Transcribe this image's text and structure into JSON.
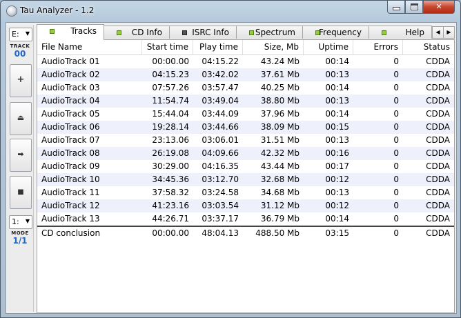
{
  "window": {
    "title": "Tau Analyzer - 1.2"
  },
  "sidebar": {
    "drive": "E:",
    "track_label": "TRACK",
    "track_value": "00",
    "buttons": [
      {
        "icon": "plus-icon",
        "glyph": "+"
      },
      {
        "icon": "eject-icon",
        "glyph": "⏏"
      },
      {
        "icon": "play-icon",
        "glyph": "➡"
      },
      {
        "icon": "stop-icon",
        "glyph": "■"
      }
    ],
    "mode_select": "1:",
    "mode_label": "MODE",
    "mode_value": "1/1"
  },
  "tabs": [
    {
      "label": "Tracks",
      "active": true,
      "dot": "green"
    },
    {
      "label": "CD Info",
      "active": false,
      "dot": "green"
    },
    {
      "label": "ISRC Info",
      "active": false,
      "dot": "grey"
    },
    {
      "label": "Spectrum",
      "active": false,
      "dot": "green"
    },
    {
      "label": "Frequency",
      "active": false,
      "dot": "green"
    },
    {
      "label": "Help",
      "active": false,
      "dot": "green"
    }
  ],
  "table": {
    "columns": [
      "File Name",
      "Start time",
      "Play time",
      "Size, Mb",
      "Uptime",
      "Errors",
      "Status"
    ],
    "rows": [
      [
        "AudioTrack 01",
        "00:00.00",
        "04:15.22",
        "43.24 Mb",
        "00:14",
        "0",
        "CDDA"
      ],
      [
        "AudioTrack 02",
        "04:15.23",
        "03:42.02",
        "37.61 Mb",
        "00:13",
        "0",
        "CDDA"
      ],
      [
        "AudioTrack 03",
        "07:57.26",
        "03:57.47",
        "40.25 Mb",
        "00:14",
        "0",
        "CDDA"
      ],
      [
        "AudioTrack 04",
        "11:54.74",
        "03:49.04",
        "38.80 Mb",
        "00:13",
        "0",
        "CDDA"
      ],
      [
        "AudioTrack 05",
        "15:44.04",
        "03:44.09",
        "37.96 Mb",
        "00:14",
        "0",
        "CDDA"
      ],
      [
        "AudioTrack 06",
        "19:28.14",
        "03:44.66",
        "38.09 Mb",
        "00:15",
        "0",
        "CDDA"
      ],
      [
        "AudioTrack 07",
        "23:13.06",
        "03:06.01",
        "31.51 Mb",
        "00:13",
        "0",
        "CDDA"
      ],
      [
        "AudioTrack 08",
        "26:19.08",
        "04:09.66",
        "42.32 Mb",
        "00:16",
        "0",
        "CDDA"
      ],
      [
        "AudioTrack 09",
        "30:29.00",
        "04:16.35",
        "43.44 Mb",
        "00:17",
        "0",
        "CDDA"
      ],
      [
        "AudioTrack 10",
        "34:45.36",
        "03:12.70",
        "32.68 Mb",
        "00:12",
        "0",
        "CDDA"
      ],
      [
        "AudioTrack 11",
        "37:58.32",
        "03:24.58",
        "34.68 Mb",
        "00:13",
        "0",
        "CDDA"
      ],
      [
        "AudioTrack 12",
        "41:23.16",
        "03:03.54",
        "31.12 Mb",
        "00:12",
        "0",
        "CDDA"
      ],
      [
        "AudioTrack 13",
        "44:26.71",
        "03:37.17",
        "36.79 Mb",
        "00:14",
        "0",
        "CDDA"
      ]
    ],
    "summary": [
      "CD conclusion",
      "00:00.00",
      "48:04.13",
      "488.50 Mb",
      "03:15",
      "0",
      "CDDA"
    ]
  }
}
